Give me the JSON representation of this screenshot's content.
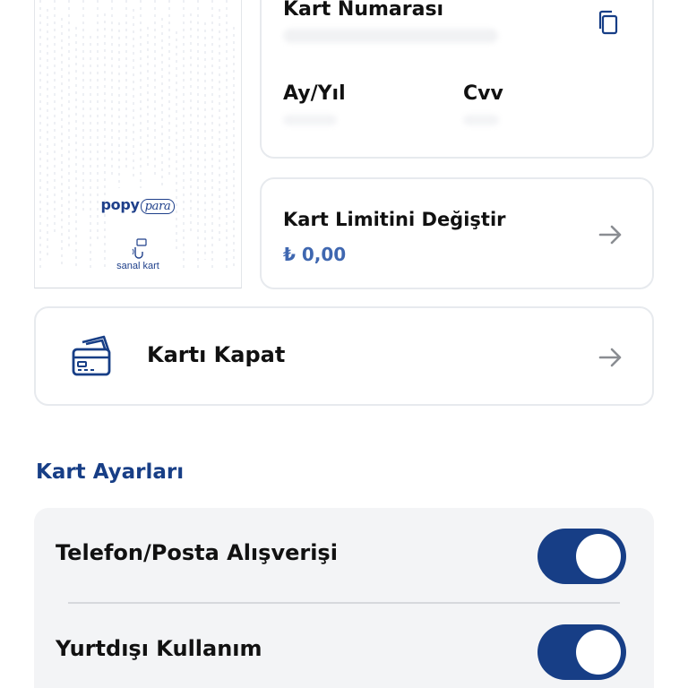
{
  "virtual_card": {
    "brand_main": "popy",
    "brand_sub": "para",
    "label": "sanal kart"
  },
  "card_info": {
    "number_label": "Kart Numarası",
    "expiry_label": "Ay/Yıl",
    "cvv_label": "Cvv",
    "copy_icon": "copy-icon"
  },
  "limit": {
    "title": "Kart Limitini Değiştir",
    "amount": "₺ 0,00",
    "arrow_icon": "arrow-right-icon"
  },
  "close_card": {
    "title": "Kartı Kapat",
    "icon": "credit-card-icon",
    "arrow_icon": "arrow-right-icon"
  },
  "settings": {
    "section_title": "Kart Ayarları",
    "items": [
      {
        "label": "Telefon/Posta Alışverişi",
        "enabled": true
      },
      {
        "label": "Yurtdışı Kullanım",
        "enabled": true
      }
    ]
  },
  "colors": {
    "accent": "#173e86",
    "amount": "#3f67b0",
    "border": "#e7eaee",
    "settings_bg": "#f3f4f6"
  }
}
